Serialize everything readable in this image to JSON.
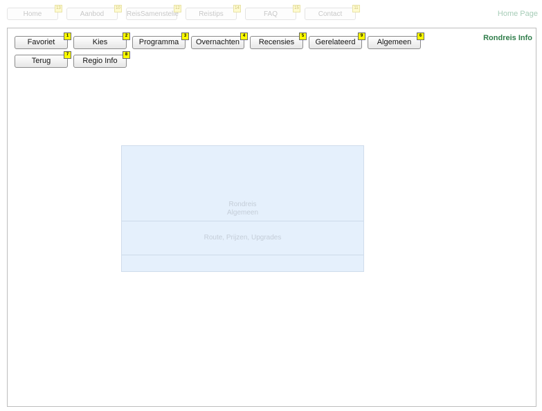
{
  "top_nav": {
    "items": [
      {
        "label": "Home",
        "badge": "13"
      },
      {
        "label": "Aanbod",
        "badge": "10"
      },
      {
        "label": "ReisSamenstelle",
        "badge": "12"
      },
      {
        "label": "Reistips",
        "badge": "14"
      },
      {
        "label": "FAQ",
        "badge": "15"
      },
      {
        "label": "Contact",
        "badge": "11"
      }
    ],
    "page_title": "Home Page"
  },
  "main": {
    "title": "Rondreis Info",
    "buttons": [
      {
        "label": "Favoriet",
        "badge": "1"
      },
      {
        "label": "Kies",
        "badge": "2"
      },
      {
        "label": "Programma",
        "badge": "3"
      },
      {
        "label": "Overnachten",
        "badge": "4"
      },
      {
        "label": "Recensies",
        "badge": "5"
      },
      {
        "label": "Gerelateerd",
        "badge": "9"
      },
      {
        "label": "Algemeen",
        "badge": "6"
      },
      {
        "label": "Terug",
        "badge": "7"
      },
      {
        "label": "Regio Info",
        "badge": "8"
      }
    ],
    "infobox": {
      "line1": "Rondreis",
      "line2": "Algemeen",
      "line3": "Route, Prijzen, Upgrades"
    }
  }
}
